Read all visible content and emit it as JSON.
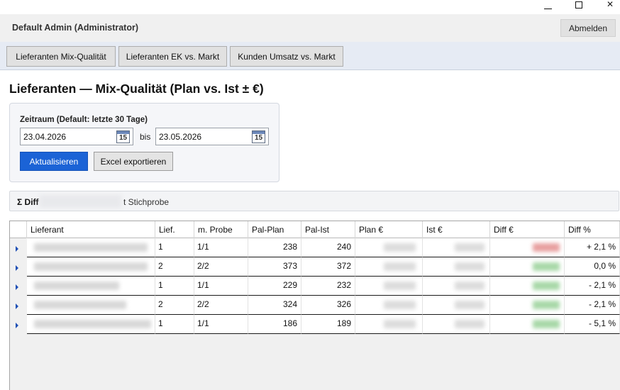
{
  "window": {
    "controls": [
      "minimize",
      "maximize",
      "close"
    ],
    "close_glyph": "✕"
  },
  "header": {
    "user_label": "Default Admin (Administrator)",
    "logout_label": "Abmelden"
  },
  "nav": {
    "tabs": [
      {
        "label": "Lieferanten Mix-Qualität"
      },
      {
        "label": "Lieferanten EK vs. Markt"
      },
      {
        "label": "Kunden Umsatz vs. Markt"
      }
    ]
  },
  "page": {
    "title": "Lieferanten — Mix-Qualität (Plan vs. Ist ± €)"
  },
  "filter": {
    "range_label": "Zeitraum (Default: letzte 30 Tage)",
    "from_date": "23.04.2026",
    "to_separator": "bis",
    "to_date": "23.05.2026",
    "calendar_day": "15",
    "refresh_label": "Aktualisieren",
    "export_label": "Excel exportieren"
  },
  "summary": {
    "prefix": "Σ Diff",
    "suffix_text": "t Stichprobe"
  },
  "grid": {
    "columns": [
      "Lieferant",
      "Lief.",
      "m. Probe",
      "Pal-Plan",
      "Pal-Ist",
      "Plan €",
      "Ist €",
      "Diff €",
      "Diff %"
    ],
    "rows": [
      {
        "lief": "1",
        "probe": "1/1",
        "pal_plan": "238",
        "pal_ist": "240",
        "diff_pct": "+ 2,1 %",
        "diff_color": "#e8a0a0"
      },
      {
        "lief": "2",
        "probe": "2/2",
        "pal_plan": "373",
        "pal_ist": "372",
        "diff_pct": "0,0 %",
        "diff_color": "#a8d8a8"
      },
      {
        "lief": "1",
        "probe": "1/1",
        "pal_plan": "229",
        "pal_ist": "232",
        "diff_pct": "- 2,1 %",
        "diff_color": "#a8d8a8"
      },
      {
        "lief": "2",
        "probe": "2/2",
        "pal_plan": "324",
        "pal_ist": "326",
        "diff_pct": "- 2,1 %",
        "diff_color": "#a8d8a8"
      },
      {
        "lief": "1",
        "probe": "1/1",
        "pal_plan": "186",
        "pal_ist": "189",
        "diff_pct": "- 5,1 %",
        "diff_color": "#a8d8a8"
      }
    ]
  },
  "colors": {
    "accent": "#1b63d6",
    "nav_bg": "#e6ebf4",
    "header_bg": "#f0f0f0"
  }
}
